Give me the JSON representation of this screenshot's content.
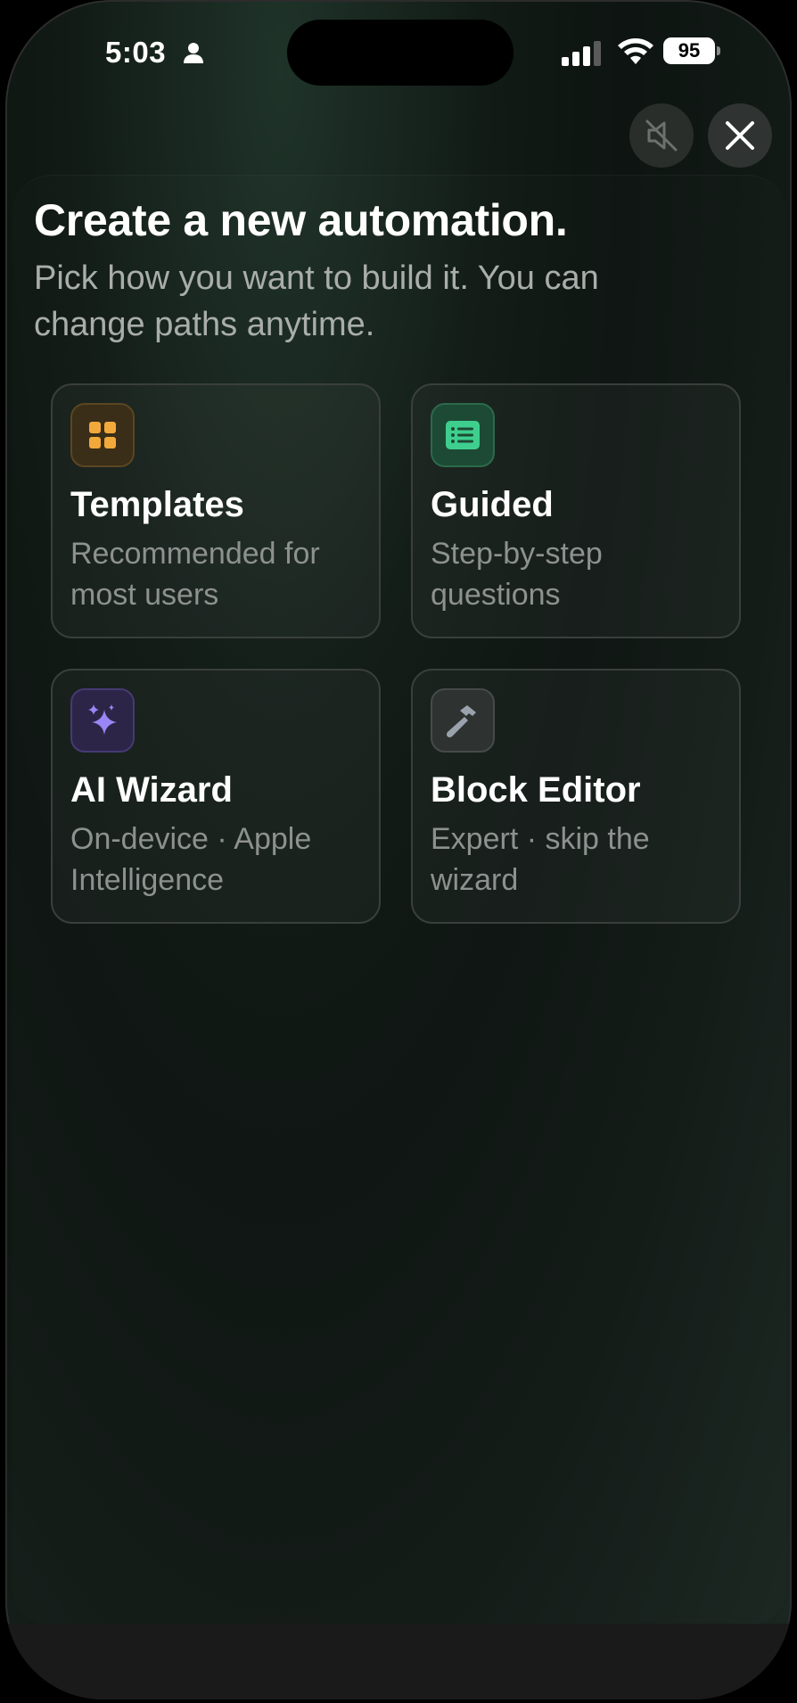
{
  "status_bar": {
    "time": "5:03",
    "battery": "95",
    "icons": [
      "person-icon",
      "cellular-signal-icon",
      "wifi-icon",
      "battery-icon"
    ]
  },
  "top_controls": {
    "mute_icon": "speaker-muted-icon",
    "close_icon": "close-icon"
  },
  "header": {
    "title": "Create a new automation.",
    "subtitle": "Pick how you want to build it. You can change paths anytime."
  },
  "options": [
    {
      "label": "Templates",
      "description": "Recommended for most users",
      "icon": "grid-icon",
      "accent": "#f2a93b"
    },
    {
      "label": "Guided",
      "description": "Step-by-step questions",
      "icon": "list-icon",
      "accent": "#3ecf8e"
    },
    {
      "label": "AI Wizard",
      "description": "On-device · Apple Intelligence",
      "icon": "sparkles-icon",
      "accent": "#9b86f5"
    },
    {
      "label": "Block Editor",
      "description": "Expert · skip the wizard",
      "icon": "hammer-icon",
      "accent": "#9aa3ad"
    }
  ]
}
